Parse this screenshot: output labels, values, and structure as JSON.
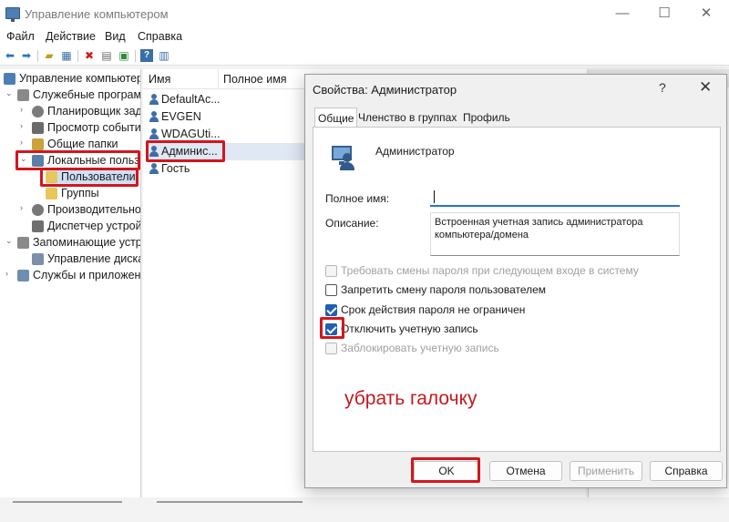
{
  "window": {
    "title": "Управление компьютером",
    "controls": {
      "minimize": "—",
      "maximize": "☐",
      "close": "✕"
    }
  },
  "menu": [
    "Файл",
    "Действие",
    "Вид",
    "Справка"
  ],
  "tree": {
    "root": "Управление компьютер",
    "items": [
      {
        "label": "Служебные програм",
        "icon": "tools-icon"
      },
      {
        "label": "Планировщик зад",
        "icon": "clock-icon"
      },
      {
        "label": "Просмотр событи",
        "icon": "event-viewer-icon"
      },
      {
        "label": "Общие папки",
        "icon": "shared-folder-icon"
      },
      {
        "label": "Локальные польз",
        "icon": "users-icon"
      },
      {
        "label": "Пользователи",
        "icon": "folder-icon"
      },
      {
        "label": "Группы",
        "icon": "folder-icon"
      },
      {
        "label": "Производительно",
        "icon": "performance-icon"
      },
      {
        "label": "Диспетчер устрой",
        "icon": "device-manager-icon"
      },
      {
        "label": "Запоминающие устр",
        "icon": "storage-icon"
      },
      {
        "label": "Управление диска",
        "icon": "disk-icon"
      },
      {
        "label": "Службы и приложен",
        "icon": "services-icon"
      }
    ]
  },
  "list": {
    "columns": [
      "Имя",
      "Полное имя"
    ],
    "rows": [
      "DefaultAc...",
      "EVGEN",
      "WDAGUti...",
      "Админис...",
      "Гость"
    ]
  },
  "dialog": {
    "title": "Свойства: Администратор",
    "help": "?",
    "close": "✕",
    "tabs": [
      "Общие",
      "Членство в группах",
      "Профиль"
    ],
    "user_name": "Администратор",
    "full_name_label": "Полное имя:",
    "full_name_value": "",
    "description_label": "Описание:",
    "description_value": "Встроенная учетная запись администратора компьютера/домена",
    "checkboxes": [
      {
        "label": "Требовать смены пароля при следующем входе в систему",
        "checked": false,
        "disabled": true
      },
      {
        "label": "Запретить смену пароля пользователем",
        "checked": false,
        "disabled": false
      },
      {
        "label": "Срок действия пароля не ограничен",
        "checked": true,
        "disabled": false
      },
      {
        "label": "Отключить учетную запись",
        "checked": true,
        "disabled": false
      },
      {
        "label": "Заблокировать учетную запись",
        "checked": false,
        "disabled": true
      }
    ],
    "annotation": "убрать галочку",
    "buttons": {
      "ok": "OK",
      "cancel": "Отмена",
      "apply": "Применить",
      "help": "Справка"
    }
  },
  "colors": {
    "highlight": "#d3161d",
    "accent": "#1f5fb4"
  }
}
